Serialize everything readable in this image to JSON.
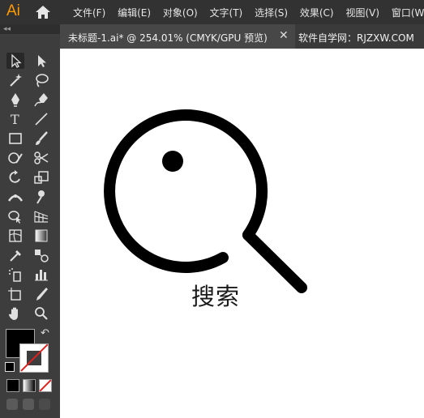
{
  "app": {
    "logo_text": "Ai"
  },
  "menu": {
    "items": [
      "文件(F)",
      "编辑(E)",
      "对象(O)",
      "文字(T)",
      "选择(S)",
      "效果(C)",
      "视图(V)",
      "窗口(W)"
    ]
  },
  "document_tab": {
    "title": "未标题-1.ai* @ 254.01% (CMYK/GPU 预览)",
    "close_glyph": "✕"
  },
  "site_label": "软件自学网：RJZXW.COM",
  "toolbar": {
    "collapse_glyph": "◂◂",
    "swap_glyph": "↶"
  },
  "artwork": {
    "caption": "搜索"
  },
  "colors": {
    "menubar": "#323232",
    "toolbar": "#3d3d3d",
    "canvas": "#ffffff",
    "logo": "#ff9a00",
    "stroke_none": "#e02020"
  }
}
